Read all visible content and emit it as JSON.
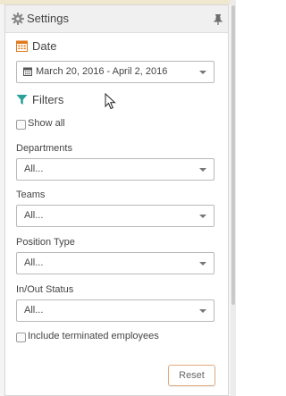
{
  "panel": {
    "title": "Settings",
    "header_icon": "gear-icon",
    "pin_icon": "pin-icon"
  },
  "date_section": {
    "title": "Date",
    "icon": "calendar-icon",
    "range_value": "March 20, 2016 - April 2, 2016",
    "range_icon": "calendar-small-icon"
  },
  "filters_section": {
    "title": "Filters",
    "icon": "funnel-icon",
    "show_all_label": "Show all",
    "show_all_checked": false
  },
  "filters": [
    {
      "label": "Departments",
      "value": "All..."
    },
    {
      "label": "Teams",
      "value": "All..."
    },
    {
      "label": "Position Type",
      "value": "All..."
    },
    {
      "label": "In/Out Status",
      "value": "All..."
    }
  ],
  "include_terminated": {
    "label": "Include terminated employees",
    "checked": false
  },
  "buttons": {
    "reset_label": "Reset"
  },
  "colors": {
    "date_icon": "#e07a1f",
    "filter_icon": "#2aa198",
    "reset_border": "#e0a97e"
  }
}
